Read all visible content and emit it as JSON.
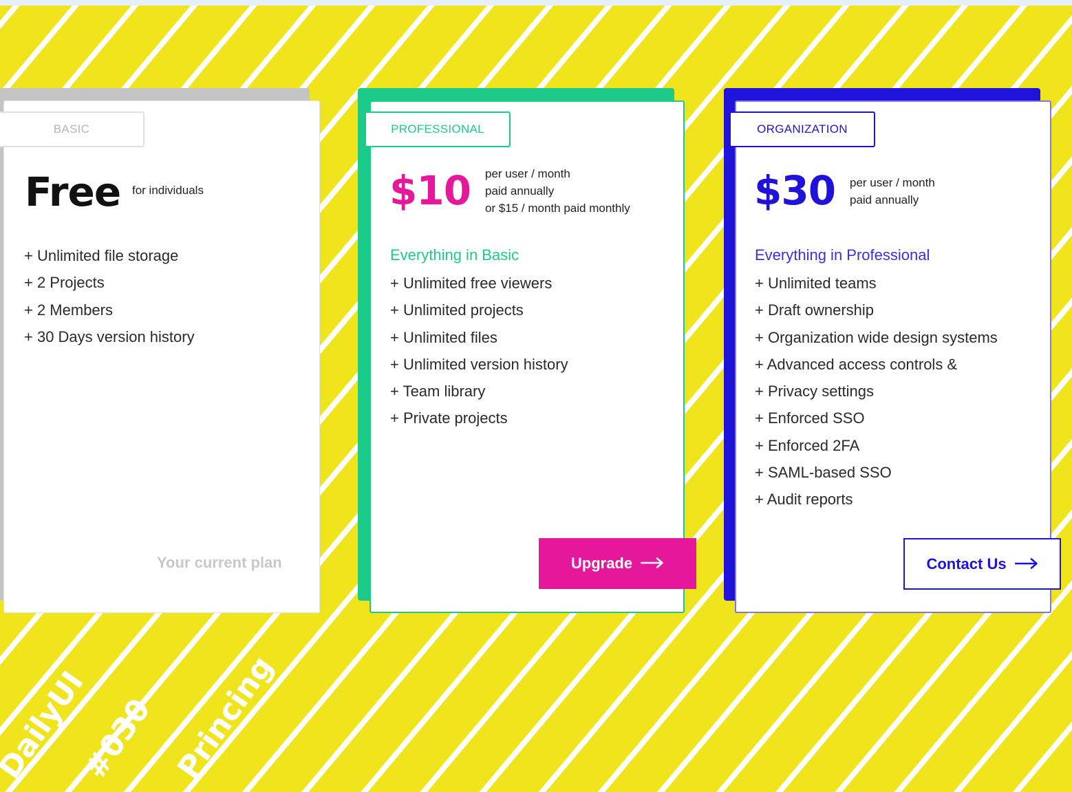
{
  "colors": {
    "background": "#f0e51d",
    "stripes": "#ffffff",
    "basic_accent": "#c4c4c4",
    "professional_accent": "#1ccb8a",
    "professional_price": "#e5179b",
    "organization_accent": "#1f13d9"
  },
  "plans": {
    "basic": {
      "tag": "BASIC",
      "price": "Free",
      "price_note": "for individuals",
      "features": [
        "+ Unlimited file storage",
        "+ 2 Projects",
        "+ 2 Members",
        "+ 30 Days version history"
      ],
      "status": "Your current plan"
    },
    "professional": {
      "tag": "PROFESSIONAL",
      "price": "$10",
      "price_note_lines": [
        "per user / month",
        "paid annually",
        "or $15 / month paid monthly"
      ],
      "section_label": "Everything in Basic",
      "features": [
        "+ Unlimited free viewers",
        "+ Unlimited projects",
        "+ Unlimited files",
        "+ Unlimited version history",
        "+ Team library",
        "+ Private projects"
      ],
      "button_label": "Upgrade",
      "button_icon": "arrow-right-icon"
    },
    "organization": {
      "tag": "ORGANIZATION",
      "price": "$30",
      "price_note_lines": [
        "per user / month",
        "paid annually"
      ],
      "section_label": "Everything in Professional",
      "features": [
        "+ Unlimited teams",
        "+ Draft ownership",
        "+ Organization wide design systems",
        "+ Advanced access controls &",
        "+ Privacy settings",
        "+ Enforced SSO",
        "+ Enforced 2FA",
        "+ SAML-based SSO",
        "+ Audit reports"
      ],
      "button_label": "Contact Us",
      "button_icon": "arrow-right-icon"
    }
  },
  "stamp": {
    "word1": "DailyUI",
    "word2": "#030",
    "word3": "Princing"
  }
}
